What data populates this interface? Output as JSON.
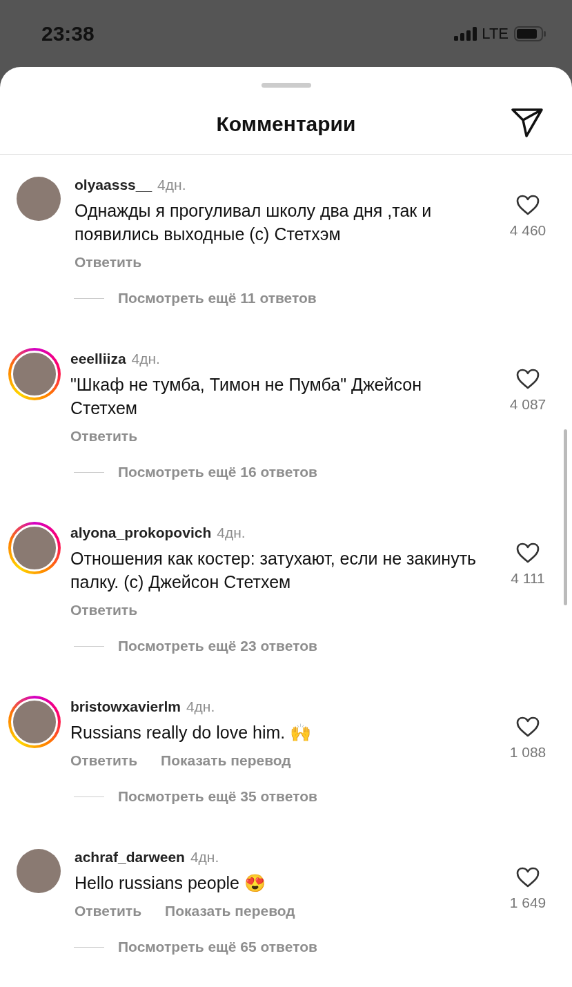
{
  "status_bar": {
    "time": "23:38",
    "network": "LTE"
  },
  "sheet": {
    "title": "Комментарии"
  },
  "comments": [
    {
      "username": "olyaasss__",
      "time": "4дн.",
      "text": "Однажды я прогуливал школу два дня ,так и появились выходные (с) Стетхэм",
      "likes": "4 460",
      "reply": "Ответить",
      "has_story": false,
      "view_replies": "Посмотреть ещё 11 ответов"
    },
    {
      "username": "eeelliiza",
      "time": "4дн.",
      "text": "\"Шкаф не тумба, Тимон не Пумба\" Джейсон Стетхем",
      "likes": "4 087",
      "reply": "Ответить",
      "has_story": true,
      "view_replies": "Посмотреть ещё 16 ответов"
    },
    {
      "username": "alyona_prokopovich",
      "time": "4дн.",
      "text": "Отношения как костер: затухают, если не закинуть палку. (с) Джейсон Стетхем",
      "likes": "4 111",
      "reply": "Ответить",
      "has_story": true,
      "view_replies": "Посмотреть ещё 23 ответов"
    },
    {
      "username": "bristowxavierlm",
      "time": "4дн.",
      "text": "Russians really do love him. 🙌",
      "likes": "1 088",
      "reply": "Ответить",
      "translate": "Показать перевод",
      "has_story": true,
      "view_replies": "Посмотреть ещё 35 ответов"
    },
    {
      "username": "achraf_darween",
      "time": "4дн.",
      "text": "Hello russians people 😍",
      "likes": "1 649",
      "reply": "Ответить",
      "translate": "Показать перевод",
      "has_story": false,
      "view_replies": "Посмотреть ещё 65 ответов"
    }
  ]
}
